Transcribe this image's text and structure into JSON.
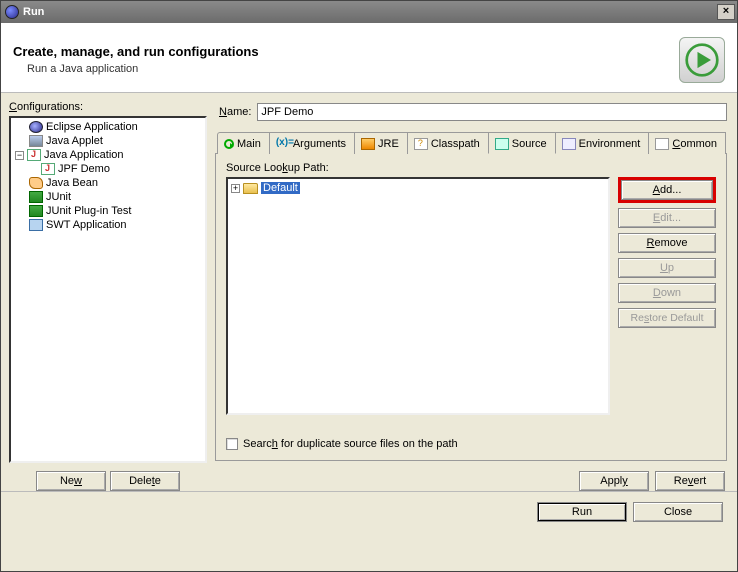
{
  "window": {
    "title": "Run",
    "close_glyph": "×"
  },
  "header": {
    "title": "Create, manage, and run configurations",
    "subtitle": "Run a Java application"
  },
  "left": {
    "label": "Configurations:",
    "items": [
      {
        "label": "Eclipse Application",
        "icon": "eclipse",
        "expander": ""
      },
      {
        "label": "Java Applet",
        "icon": "applet",
        "expander": ""
      },
      {
        "label": "Java Application",
        "icon": "java",
        "expander": "−",
        "children": [
          {
            "label": "JPF Demo",
            "icon": "java"
          }
        ]
      },
      {
        "label": "Java Bean",
        "icon": "bean",
        "expander": ""
      },
      {
        "label": "JUnit",
        "icon": "junit",
        "expander": ""
      },
      {
        "label": "JUnit Plug-in Test",
        "icon": "junit",
        "expander": ""
      },
      {
        "label": "SWT Application",
        "icon": "swt",
        "expander": ""
      }
    ],
    "new_btn": "New",
    "delete_btn": "Delete"
  },
  "name": {
    "label": "Name:",
    "value": "JPF Demo"
  },
  "tabs": {
    "main": "Main",
    "arguments": "Arguments",
    "jre": "JRE",
    "classpath": "Classpath",
    "source": "Source",
    "environment": "Environment",
    "common": "Common"
  },
  "source_tab": {
    "lookup_label": "Source Lookup Path:",
    "default_item": "Default",
    "buttons": {
      "add": "Add...",
      "edit": "Edit...",
      "remove": "Remove",
      "up": "Up",
      "down": "Down",
      "restore": "Restore Default"
    },
    "checkbox_label": "Search for duplicate source files on the path"
  },
  "apply_revert": {
    "apply": "Apply",
    "revert": "Revert"
  },
  "footer": {
    "run": "Run",
    "close": "Close"
  }
}
